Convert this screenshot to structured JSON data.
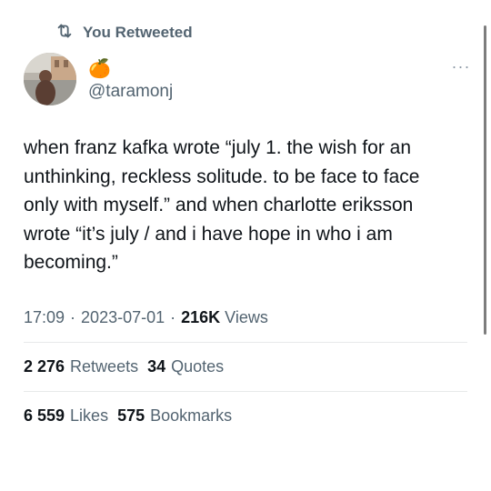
{
  "retweet_banner": {
    "label": "You Retweeted",
    "icon": "retweet-icon"
  },
  "author": {
    "display_name_emoji": "🍊",
    "handle": "@taramonj"
  },
  "more_menu": {
    "label": "···"
  },
  "tweet": {
    "text": "when franz kafka wrote “july 1. the wish for an\nunthinking, reckless solitude. to be face to face\nonly with myself.” and when charlotte eriksson\nwrote “it’s july / and i have hope in who i am\nbecoming.”"
  },
  "meta": {
    "time": "17:09",
    "separator": "·",
    "date": "2023-07-01",
    "views_count": "216K",
    "views_label": "Views"
  },
  "stats": {
    "retweets_count": "2 276",
    "retweets_label": "Retweets",
    "quotes_count": "34",
    "quotes_label": "Quotes",
    "likes_count": "6 559",
    "likes_label": "Likes",
    "bookmarks_count": "575",
    "bookmarks_label": "Bookmarks"
  },
  "colors": {
    "text": "#0f1419",
    "secondary": "#536471",
    "divider": "#e7e9ea"
  }
}
